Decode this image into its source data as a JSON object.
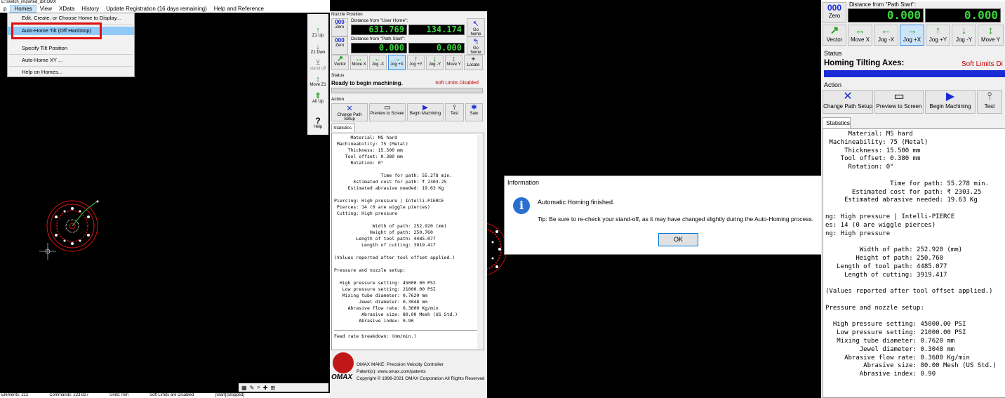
{
  "window": {
    "title_fragment": "E:\\sketch_imported_dxf.OMX"
  },
  "menubar": {
    "items": [
      "p",
      "Homes",
      "View",
      "XData",
      "History",
      "Update Registration (16 days remaining)",
      "Help and Reference"
    ]
  },
  "homes_menu": {
    "items": [
      "Edit, Create, or Choose Home to Display...",
      "Auto-Home Tilt (Off Hardstop)",
      "Specify Tilt Position",
      "Auto-Home XY ...",
      "Help on Homes..."
    ]
  },
  "vtoolbar": {
    "z1_up": "Z1 Up",
    "z1_dwn": "Z1 Dwn",
    "stand_off": "stand off",
    "move_z1": "Move Z1",
    "all_up": "All Up",
    "help": "Help"
  },
  "nozzle": {
    "section": "Nozzle Position",
    "from_user_home": "Distance from \"User Home\":",
    "from_path_start": "Distance from \"Path Start\":",
    "units_badge": "000",
    "zero": "Zero",
    "user_home_x": "631.769",
    "user_home_y": "134.174",
    "path_start_x": "0.000",
    "path_start_y": "0.000",
    "go_home": "Go home"
  },
  "jog": [
    "Vector",
    "Move X",
    "Jog -X",
    "Jog +X",
    "Jog +Y",
    "Jog -Y",
    "Move Y",
    "Locate"
  ],
  "jog_right": [
    "Vector",
    "Move X",
    "Jog -X",
    "Jog +X",
    "Jog +Y",
    "Jog -Y",
    "Move Y"
  ],
  "status": {
    "label": "Status",
    "text_left": "Ready to begin machining.",
    "soft_limits": "Soft Limits Disabled",
    "text_right": "Homing Tilting Axes:",
    "soft_limits_right": "Soft Limits Di"
  },
  "action": {
    "label": "Action",
    "buttons": [
      "Change Path Setup",
      "Preview to Screen",
      "Begin Machining",
      "Test",
      "Saw"
    ],
    "buttons_right": [
      "Change Path Setup",
      "Preview to Screen",
      "Begin Machining",
      "Test"
    ]
  },
  "statistics": {
    "tab": "Statistics",
    "lines": [
      "      Material: MS hard",
      " Machineability: 75 (Metal)",
      "     Thickness: 15.500 mm",
      "    Tool offset: 0.380 mm",
      "      Rotation: 0°",
      "",
      "                 Time for path: 55.278 min.",
      "       Estimated cost for path: ₹ 2303.25",
      "     Estimated abrasive needed: 19.63 Kg",
      "",
      "Piercing: High pressure | Intelli-PIERCE",
      " Pierces: 14 (0 are wiggle pierces)",
      " Cutting: High pressure",
      "",
      "              Width of path: 252.920 (mm)",
      "             Height of path: 250.760",
      "        Length of tool path: 4485.077",
      "          Length of cutting: 3919.417",
      "",
      "(Values reported after tool offset applied.)",
      "",
      "Pressure and nozzle setup:",
      "",
      "  High pressure setting: 45000.00 PSI",
      "   Low pressure setting: 21000.00 PSI",
      "   Mixing tube diameter: 0.7620 mm",
      "         Jewel diameter: 0.3048 mm",
      "     Abrasive flow rate: 0.3600 Kg/min",
      "          Abrasive size: 80.00 Mesh (US Std.)",
      "         Abrasive index: 0.90"
    ],
    "feed_rate": "Feed rate breakdown: (mm/min.)",
    "right_lines": [
      "      Material: MS hard",
      " Machineability: 75 (Metal)",
      "     Thickness: 15.500 mm",
      "    Tool offset: 0.380 mm",
      "      Rotation: 0°",
      "",
      "                 Time for path: 55.278 min.",
      "       Estimated cost for path: ₹ 2303.25",
      "     Estimated abrasive needed: 19.63 Kg",
      "",
      "ng: High pressure | Intelli-PIERCE",
      "es: 14 (0 are wiggle pierces)",
      "ng: High pressure",
      "",
      "         Width of path: 252.920 (mm)",
      "        Height of path: 250.760",
      "   Length of tool path: 4485.077",
      "     Length of cutting: 3919.417",
      "",
      "(Values reported after tool offset applied.)",
      "",
      "Pressure and nozzle setup:",
      "",
      "  High pressure setting: 45000.00 PSI",
      "   Low pressure setting: 21000.00 PSI",
      "   Mixing tube diameter: 0.7620 mm",
      "         Jewel diameter: 0.3048 mm",
      "     Abrasive flow rate: 0.3600 Kg/min",
      "          Abrasive size: 80.00 Mesh (US Std.)",
      "         Abrasive index: 0.90"
    ]
  },
  "footer": {
    "line1": "OMAX MAKE: Precision Velocity Controller",
    "line2": "Patent(s): www.omax.com/patents",
    "line3": "Copyright © 1998-2021 OMAX Corporation All Rights Reserved",
    "logo": "OMAX"
  },
  "statusbar": {
    "items": [
      "Elements: 212",
      "Commands: 223.837",
      "Units: mm",
      "Soft Limits are Disabled",
      "[Start][Stopped]"
    ]
  },
  "dialog": {
    "title": "Information",
    "close": "✕",
    "message": "Automatic Homing finished.",
    "tip": "Tip: Be sure to re-check your stand-off, as it may have changed slightly during the Auto-Homing process.",
    "ok": "OK"
  },
  "colors": {
    "lcd_green": "#3bd43b",
    "soft_limits_red": "#c00000",
    "progress_blue": "#1a2bd6",
    "highlight": "#e01010"
  }
}
